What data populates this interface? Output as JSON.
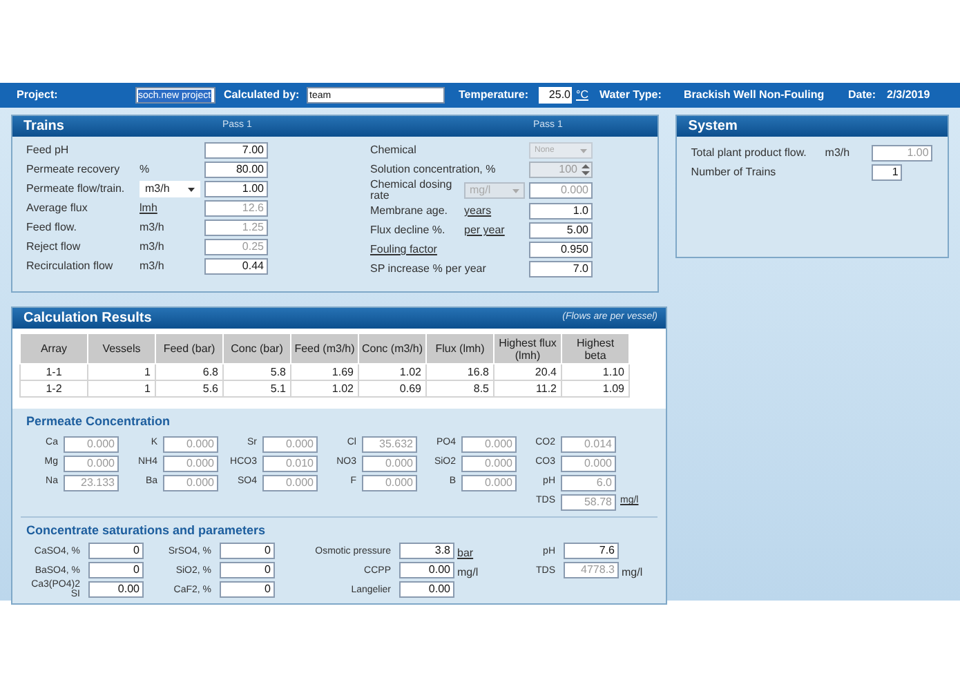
{
  "header": {
    "project": {
      "label": "Project:",
      "value": "soch.new project",
      "text_selected": true
    },
    "calculated_by": {
      "label": "Calculated by:",
      "value": "team",
      "text_selected": false
    },
    "temperature": {
      "label": "Temperature:",
      "value": "25.0",
      "unit": "°C"
    },
    "water_type": {
      "label": "Water Type:",
      "value": "Brackish Well Non-Fouling"
    },
    "date": {
      "label": "Date:",
      "value": "2/3/2019"
    }
  },
  "trains": {
    "title": "Trains",
    "pass_labels": [
      "Pass 1",
      "Pass 1"
    ],
    "left_rows": [
      {
        "label": "Feed pH",
        "label_link": false,
        "kind": "input",
        "value": "7.00",
        "disabled": false
      },
      {
        "label": "Permeate recovery",
        "label_link": false,
        "unit": {
          "text": "%",
          "kind": "plain"
        },
        "kind": "input",
        "value": "80.00",
        "disabled": false
      },
      {
        "label": "Permeate flow/train.",
        "label_link": false,
        "unit": {
          "text": "m3/h",
          "kind": "select",
          "disabled": false
        },
        "kind": "input",
        "value": "1.00",
        "disabled": false
      },
      {
        "label": "Average flux",
        "label_link": false,
        "unit": {
          "text": "lmh",
          "kind": "link"
        },
        "kind": "input",
        "value": "12.6",
        "disabled": true
      },
      {
        "label": "Feed flow.",
        "label_link": false,
        "unit": {
          "text": "m3/h",
          "kind": "plain"
        },
        "kind": "input",
        "value": "1.25",
        "disabled": true
      },
      {
        "label": "Reject flow",
        "label_link": false,
        "unit": {
          "text": "m3/h",
          "kind": "plain"
        },
        "kind": "input",
        "value": "0.25",
        "disabled": true
      },
      {
        "label": "Recirculation flow",
        "label_link": false,
        "unit": {
          "text": "m3/h",
          "kind": "plain"
        },
        "kind": "input",
        "value": "0.44",
        "disabled": false
      }
    ],
    "right_rows": [
      {
        "label": "Chemical",
        "label_link": false,
        "kind": "dropdown",
        "value": "None",
        "disabled": true
      },
      {
        "label": "Solution concentration, %",
        "label_link": false,
        "kind": "spinner",
        "value": "100",
        "disabled": true
      },
      {
        "label": "Chemical dosing rate",
        "label_link": false,
        "unit": {
          "text": "mg/l",
          "kind": "select",
          "disabled": true
        },
        "kind": "input",
        "value": "0.000",
        "disabled": true
      },
      {
        "label": "Membrane age.",
        "label_link": false,
        "unit": {
          "text": "years",
          "kind": "link"
        },
        "kind": "input",
        "value": "1.0",
        "disabled": false
      },
      {
        "label": "Flux decline %.",
        "label_link": false,
        "unit": {
          "text": "per year",
          "kind": "link"
        },
        "kind": "input",
        "value": "5.00",
        "disabled": false
      },
      {
        "label": "Fouling factor",
        "label_link": true,
        "kind": "input",
        "value": "0.950",
        "disabled": false
      },
      {
        "label": "SP increase % per year",
        "label_link": false,
        "kind": "input",
        "value": "7.0",
        "disabled": false
      }
    ]
  },
  "system": {
    "title": "System",
    "rows": [
      {
        "label": "Total plant product flow.",
        "unit": "m3/h",
        "value": "1.00",
        "disabled": true
      },
      {
        "label": "Number of Trains",
        "value": "1",
        "disabled": false
      }
    ]
  },
  "results": {
    "title": "Calculation Results",
    "note": "(Flows are per vessel)",
    "table": {
      "columns": [
        "Array",
        "Vessels",
        "Feed (bar)",
        "Conc (bar)",
        "Feed (m3/h)",
        "Conc (m3/h)",
        "Flux (lmh)",
        "Highest flux (lmh)",
        "Highest beta"
      ],
      "rows": [
        [
          "1-1",
          "1",
          "6.8",
          "5.8",
          "1.69",
          "1.02",
          "16.8",
          "20.4",
          "1.10"
        ],
        [
          "1-2",
          "1",
          "5.6",
          "5.1",
          "1.02",
          "0.69",
          "8.5",
          "11.2",
          "1.09"
        ]
      ]
    },
    "permeate": {
      "title": "Permeate Concentration",
      "rows": [
        [
          {
            "label": "Ca",
            "value": "0.000"
          },
          {
            "label": "K",
            "value": "0.000"
          },
          {
            "label": "Sr",
            "value": "0.000"
          },
          {
            "label": "Cl",
            "value": "35.632"
          },
          {
            "label": "PO4",
            "value": "0.000"
          },
          {
            "label": "CO2",
            "value": "0.014"
          }
        ],
        [
          {
            "label": "Mg",
            "value": "0.000"
          },
          {
            "label": "NH4",
            "value": "0.000"
          },
          {
            "label": "HCO3",
            "value": "0.010"
          },
          {
            "label": "NO3",
            "value": "0.000"
          },
          {
            "label": "SiO2",
            "value": "0.000"
          },
          {
            "label": "CO3",
            "value": "0.000"
          }
        ],
        [
          {
            "label": "Na",
            "value": "23.133"
          },
          {
            "label": "Ba",
            "value": "0.000"
          },
          {
            "label": "SO4",
            "value": "0.000"
          },
          {
            "label": "F",
            "value": "0.000"
          },
          {
            "label": "B",
            "value": "0.000"
          },
          {
            "label": "pH",
            "value": "6.0"
          }
        ]
      ],
      "tds": {
        "label": "TDS",
        "value": "58.78",
        "unit": "mg/l"
      }
    },
    "concentrate": {
      "title": "Concentrate saturations and parameters",
      "columns": [
        [
          {
            "label": "CaSO4, %",
            "value": "0",
            "disabled": false
          },
          {
            "label": "BaSO4, %",
            "value": "0",
            "disabled": false
          },
          {
            "label": "Ca3(PO4)2 SI",
            "value": "0.00",
            "disabled": false
          }
        ],
        [
          {
            "label": "SrSO4, %",
            "value": "0",
            "disabled": false
          },
          {
            "label": "SiO2, %",
            "value": "0",
            "disabled": false
          },
          {
            "label": "CaF2, %",
            "value": "0",
            "disabled": false
          }
        ],
        [
          {
            "label": "Osmotic pressure",
            "value": "3.8",
            "disabled": false,
            "unit": {
              "text": "bar",
              "kind": "link"
            }
          },
          {
            "label": "CCPP",
            "value": "0.00",
            "disabled": false,
            "unit": {
              "text": "mg/l",
              "kind": "plain"
            }
          },
          {
            "label": "Langelier",
            "value": "0.00",
            "disabled": false
          }
        ],
        [
          {
            "label": "pH",
            "value": "7.6",
            "disabled": false
          },
          {
            "label": "TDS",
            "value": "4778.3",
            "disabled": true,
            "unit": {
              "text": "mg/l",
              "kind": "plain"
            }
          }
        ]
      ]
    }
  }
}
